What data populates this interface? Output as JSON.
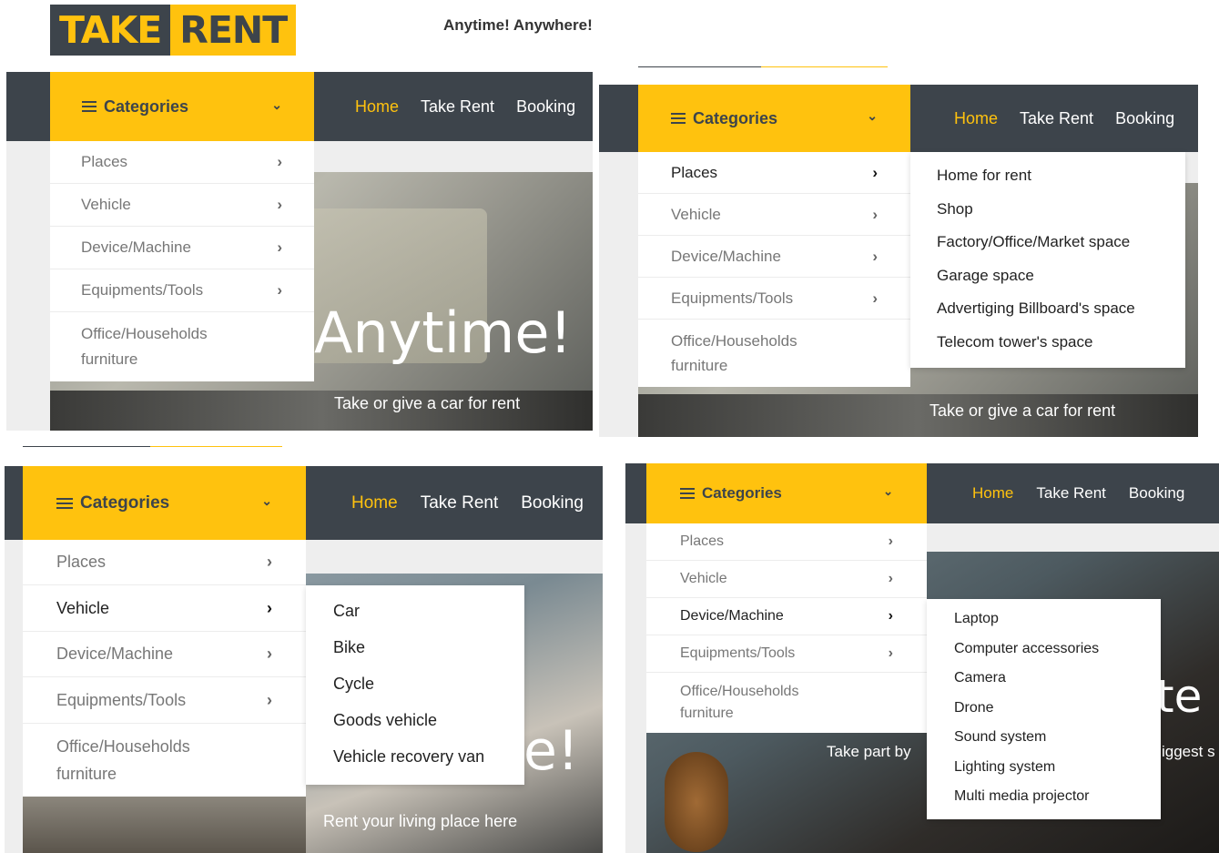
{
  "brand": {
    "take": "TAKE",
    "rent": "RENT",
    "tagline": "Anytime! Anywhere!"
  },
  "colors": {
    "accent": "#ffc20e",
    "dark": "#3d444b",
    "white": "#ffffff"
  },
  "categories_label": "Categories",
  "nav": {
    "home": "Home",
    "take_rent": "Take Rent",
    "booking": "Booking"
  },
  "categories": [
    "Places",
    "Vehicle",
    "Device/Machine",
    "Equipments/Tools",
    "Office/Households furniture"
  ],
  "panel1": {
    "hero_title": "Anytime!",
    "hero_sub": "Take or give a car for rent"
  },
  "panel2": {
    "hero_sub": "Take or give a car for rent",
    "submenu": [
      "Home for rent",
      "Shop",
      "Factory/Office/Market space",
      "Garage space",
      "Advertiging Billboard's space",
      "Telecom tower's space"
    ]
  },
  "panel3": {
    "hero_title": "e!",
    "hero_sub": "Rent your living place here",
    "submenu": [
      "Car",
      "Bike",
      "Cycle",
      "Goods vehicle",
      "Vehicle recovery van"
    ]
  },
  "panel4": {
    "hero_title": "te",
    "hero_sub_left": "Take part by",
    "hero_sub_right": "iggest s",
    "submenu": [
      "Laptop",
      "Computer accessories",
      "Camera",
      "Drone",
      "Sound system",
      "Lighting system",
      "Multi media projector"
    ]
  },
  "icons": {
    "menu": "hamburger-icon",
    "chevron_down": "chevron-down-icon",
    "chevron_right": "chevron-right-icon"
  }
}
